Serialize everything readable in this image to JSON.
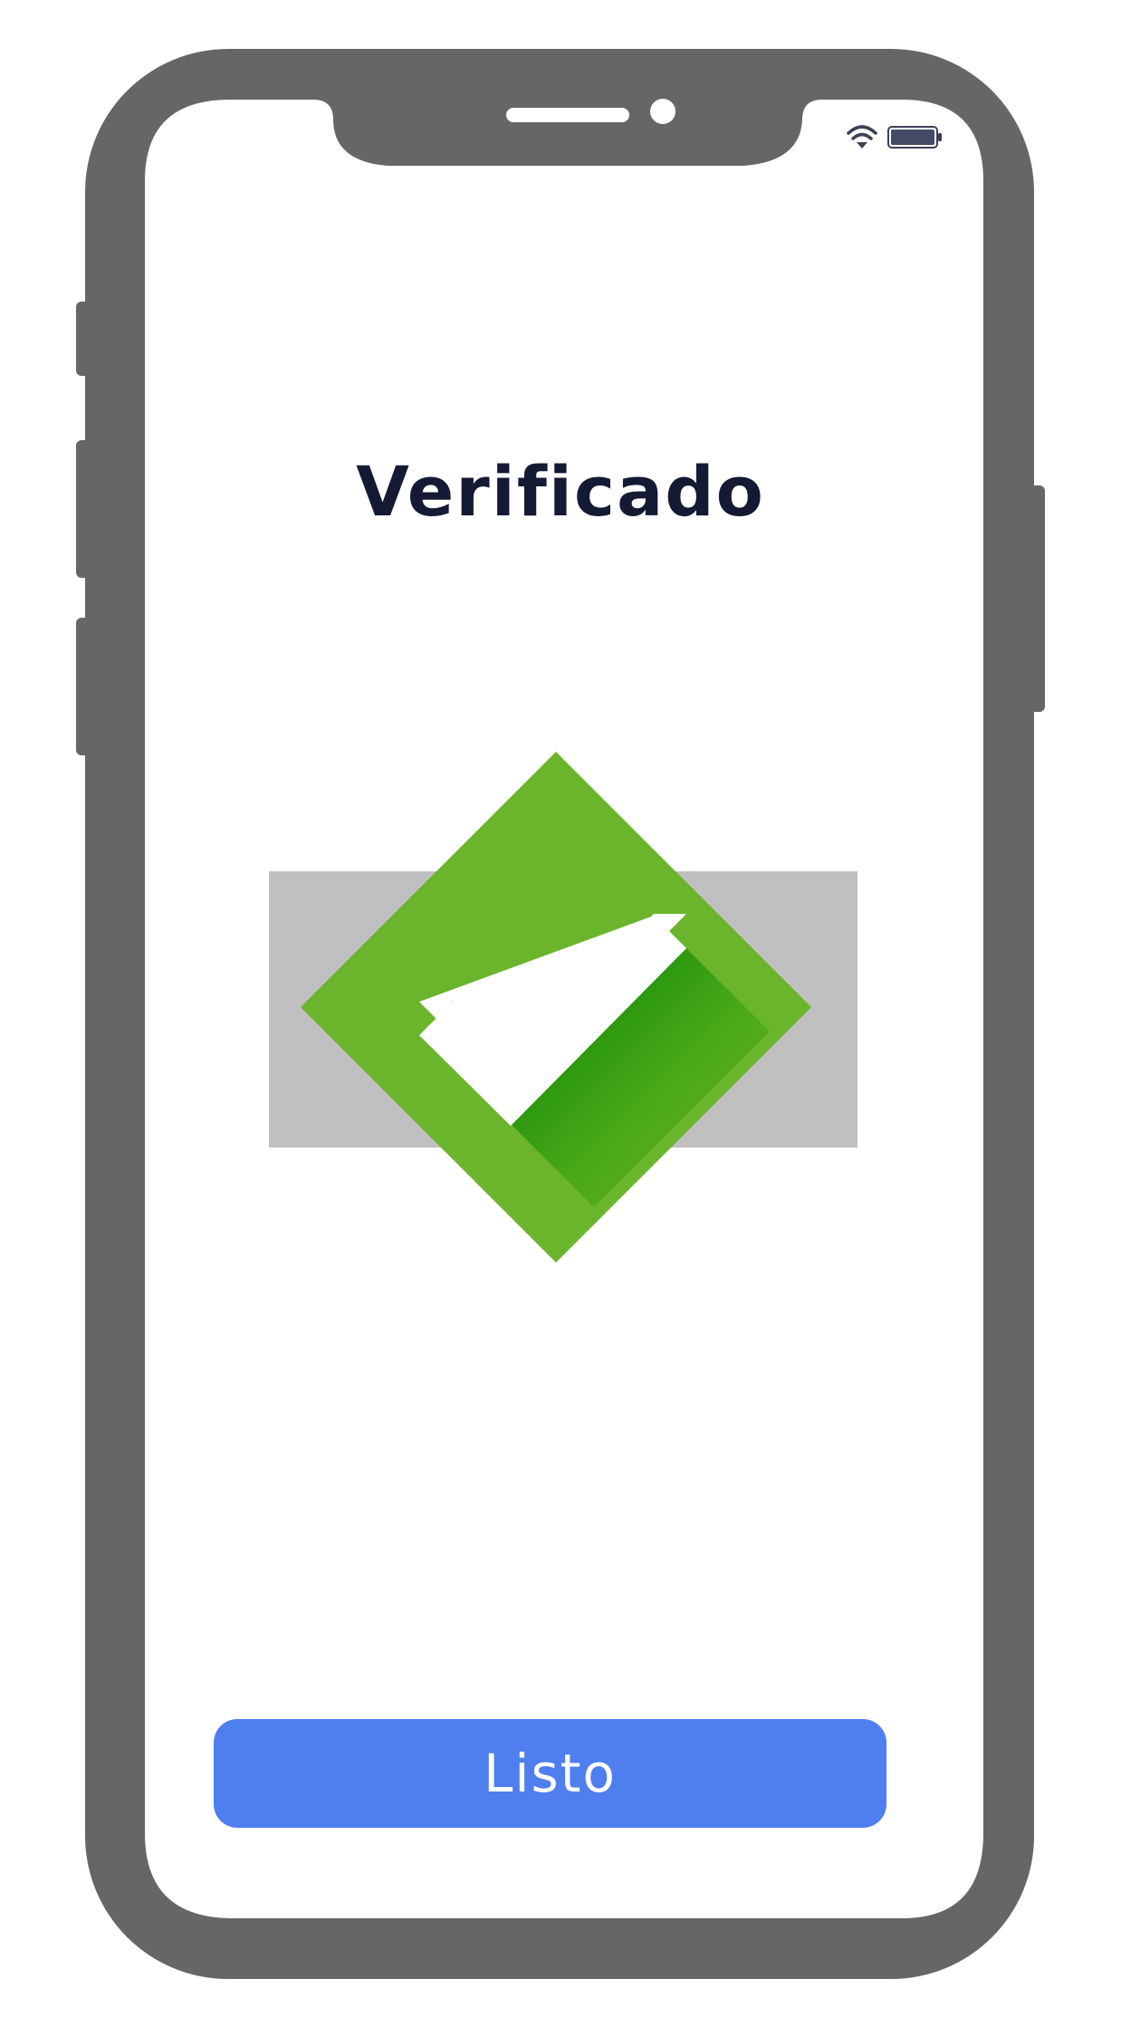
{
  "screen": {
    "title": "Verificado",
    "done_label": "Listo"
  },
  "status_bar": {
    "icons": [
      "wifi-icon",
      "battery-icon"
    ]
  },
  "verified_graphic": {
    "icon": "checkmark-icon",
    "colors": {
      "diamond": "#6bb52d",
      "card": "#c0c0c0",
      "shadow_dark": "#008000",
      "check": "#ffffff"
    }
  },
  "colors": {
    "device_frame": "#666666",
    "title_text": "#141a33",
    "button": "#4f7fee",
    "button_text": "#ffffff"
  }
}
